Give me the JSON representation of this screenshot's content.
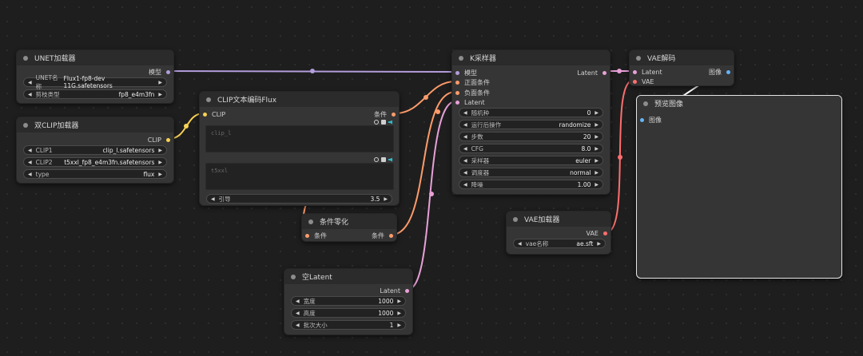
{
  "colors": {
    "model": "#b39ddb",
    "clip": "#f7d154",
    "conditioning": "#ff9b6a",
    "latent": "#e8a0d8",
    "vae": "#ff6e6e",
    "image": "#64b5f6",
    "selected_border": "#e6e6e6"
  },
  "unet_loader": {
    "title": "UNET加载器",
    "output_model": "模型",
    "widgets": [
      {
        "label": "UNET名称",
        "value": "Flux1-fp8-dev 11G.safetensors"
      },
      {
        "label": "剪枝类型",
        "value": "fp8_e4m3fn"
      }
    ]
  },
  "dual_clip_loader": {
    "title": "双CLIP加载器",
    "output_clip": "CLIP",
    "widgets": [
      {
        "label": "CLIP1",
        "value": "clip_l.safetensors"
      },
      {
        "label": "CLIP2",
        "value": "t5xxl_fp8_e4m3fn.safetensors"
      },
      {
        "label": "type",
        "value": "flux"
      }
    ]
  },
  "clip_text_encode_flux": {
    "title": "CLIP文本编码Flux",
    "input_clip": "CLIP",
    "output_conditioning": "条件",
    "textarea1_placeholder": "clip_l",
    "textarea2_placeholder": "t5xxl",
    "guidance": {
      "label": "引导",
      "value": "3.5"
    }
  },
  "conditioning_zero_out": {
    "title": "条件零化",
    "input": "条件",
    "output": "条件"
  },
  "empty_latent": {
    "title": "空Latent",
    "output": "Latent",
    "widgets": [
      {
        "label": "宽度",
        "value": "1000"
      },
      {
        "label": "高度",
        "value": "1000"
      },
      {
        "label": "批次大小",
        "value": "1"
      }
    ]
  },
  "ksampler": {
    "title": "K采样器",
    "inputs": [
      "模型",
      "正面条件",
      "负面条件",
      "Latent"
    ],
    "output": "Latent",
    "widgets": [
      {
        "label": "随机种",
        "value": "0"
      },
      {
        "label": "运行后操作",
        "value": "randomize"
      },
      {
        "label": "步数",
        "value": "20"
      },
      {
        "label": "CFG",
        "value": "8.0"
      },
      {
        "label": "采样器",
        "value": "euler"
      },
      {
        "label": "调度器",
        "value": "normal"
      },
      {
        "label": "降噪",
        "value": "1.00"
      }
    ]
  },
  "vae_decode": {
    "title": "VAE解码",
    "inputs": [
      "Latent",
      "VAE"
    ],
    "output": "图像"
  },
  "vae_loader": {
    "title": "VAE加载器",
    "output": "VAE",
    "widgets": [
      {
        "label": "vae名称",
        "value": "ae.sft"
      }
    ]
  },
  "preview_image": {
    "title": "预览图像",
    "input": "图像"
  },
  "icons": {
    "arrow_left": "◀",
    "arrow_right": "▶"
  }
}
